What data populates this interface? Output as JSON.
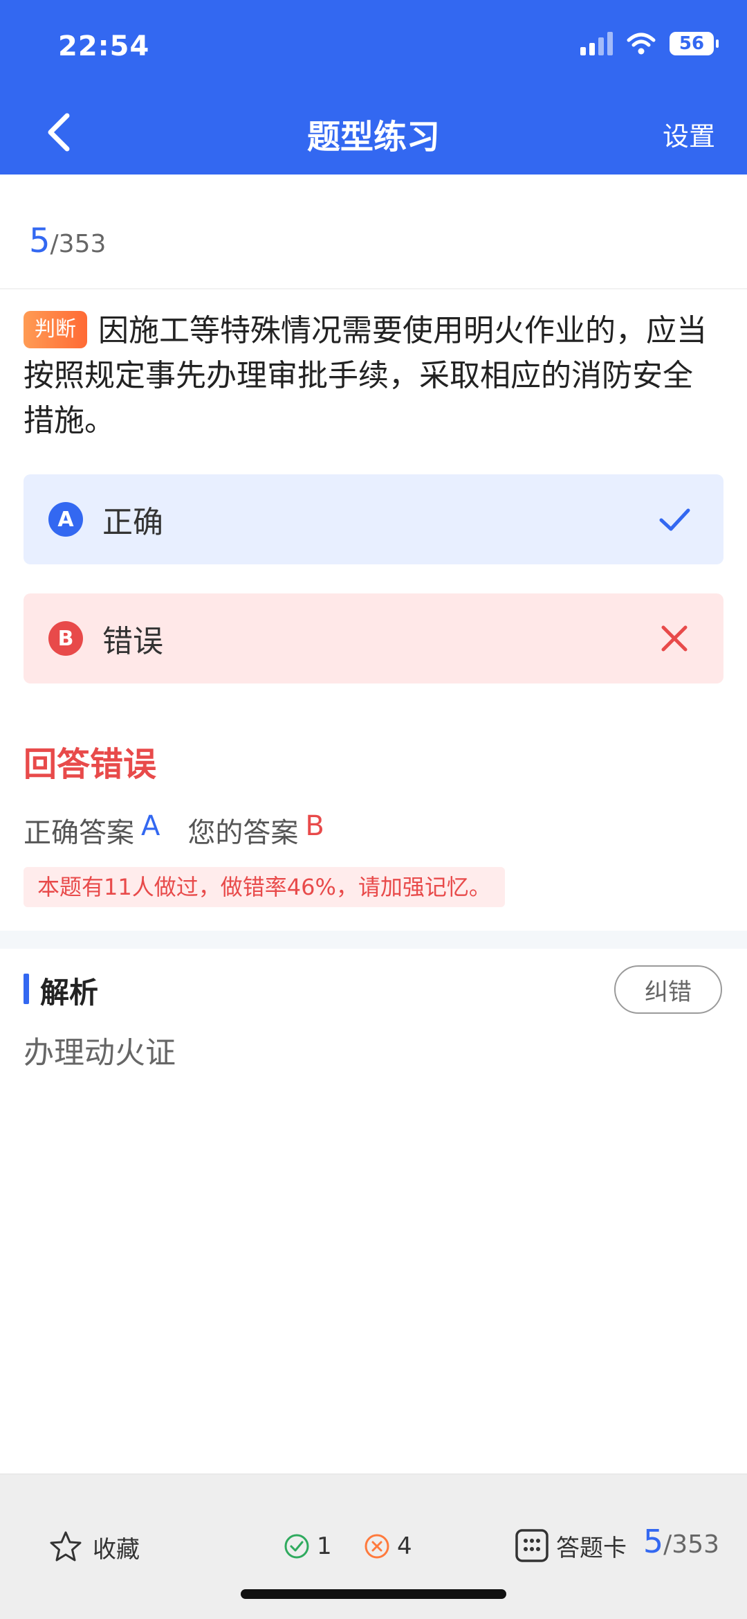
{
  "status_bar": {
    "time": "22:54",
    "battery": "56"
  },
  "nav": {
    "title": "题型练习",
    "settings": "设置"
  },
  "progress": {
    "current": "5",
    "total": "/353"
  },
  "question": {
    "type_badge": "判断",
    "text": "因施工等特殊情况需要使用明火作业的，应当按照规定事先办理审批手续，采取相应的消防安全措施。"
  },
  "options": [
    {
      "letter": "A",
      "text": "正确",
      "state": "correct"
    },
    {
      "letter": "B",
      "text": "错误",
      "state": "wrong"
    }
  ],
  "result": {
    "title": "回答错误",
    "correct_label": "正确答案",
    "correct_answer": "A",
    "your_label": "您的答案",
    "your_answer": "B",
    "stat_tip": "本题有11人做过，做错率46%，请加强记忆。"
  },
  "analysis": {
    "title": "解析",
    "correction_button": "纠错",
    "content": "办理动火证"
  },
  "bottom_bar": {
    "favorite": "收藏",
    "right_count": "1",
    "wrong_count": "4",
    "answer_card": "答题卡",
    "progress_current": "5",
    "progress_total": "/353"
  },
  "colors": {
    "primary": "#3368f1",
    "error": "#e84a4a",
    "success": "#2faa5e",
    "orange": "#ff7a3d"
  }
}
